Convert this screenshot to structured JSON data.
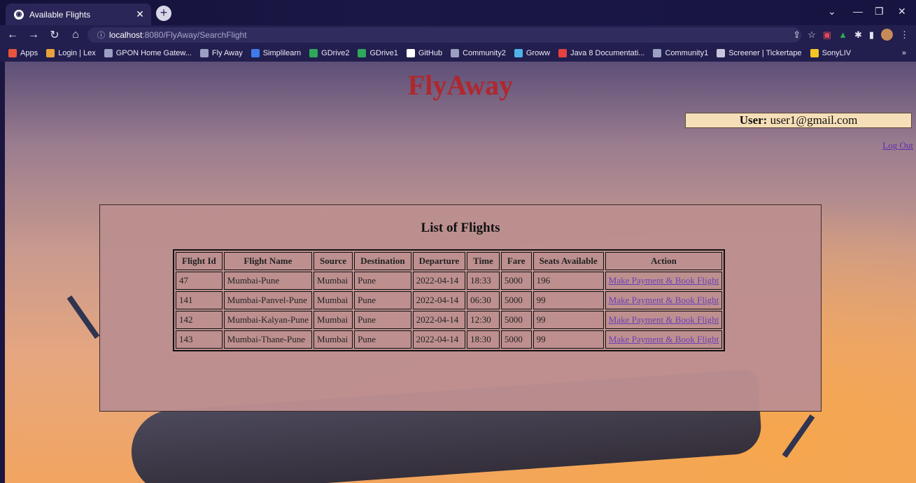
{
  "browser": {
    "tab_title": "Available Flights",
    "url_host": "localhost",
    "url_rest": ":8080/FlyAway/SearchFlight",
    "bookmarks": [
      {
        "label": "Apps",
        "color": "#e9543d"
      },
      {
        "label": "Login | Lex",
        "color": "#e8a23c"
      },
      {
        "label": "GPON Home Gatew...",
        "color": "#9aa0c2"
      },
      {
        "label": "Fly Away",
        "color": "#9aa0c2"
      },
      {
        "label": "Simplilearn",
        "color": "#3e7be8"
      },
      {
        "label": "GDrive2",
        "color": "#2fa75b"
      },
      {
        "label": "GDrive1",
        "color": "#2fa75b"
      },
      {
        "label": "GitHub",
        "color": "#ffffff"
      },
      {
        "label": "Community2",
        "color": "#9aa0c2"
      },
      {
        "label": "Groww",
        "color": "#4fb3e8"
      },
      {
        "label": "Java 8 Documentati...",
        "color": "#e64040"
      },
      {
        "label": "Community1",
        "color": "#9aa0c2"
      },
      {
        "label": "Screener | Tickertape",
        "color": "#c7c4dd"
      },
      {
        "label": "SonyLIV",
        "color": "#f3c623"
      }
    ]
  },
  "page": {
    "brand": "FlyAway",
    "user_label": "User:",
    "user_email": "user1@gmail.com",
    "logout": "Log Out",
    "list_title": "List of Flights",
    "columns": [
      "Flight Id",
      "Flight Name",
      "Source",
      "Destination",
      "Departure",
      "Time",
      "Fare",
      "Seats Available",
      "Action"
    ],
    "rows": [
      [
        "47",
        "Mumbai-Pune",
        "Mumbai",
        "Pune",
        "2022-04-14",
        "18:33",
        "5000",
        "196",
        "Make Payment & Book Flight"
      ],
      [
        "141",
        "Mumbai-Panvel-Pune",
        "Mumbai",
        "Pune",
        "2022-04-14",
        "06:30",
        "5000",
        "99",
        "Make Payment & Book Flight"
      ],
      [
        "142",
        "Mumbai-Kalyan-Pune",
        "Mumbai",
        "Pune",
        "2022-04-14",
        "12:30",
        "5000",
        "99",
        "Make Payment & Book Flight"
      ],
      [
        "143",
        "Mumbai-Thane-Pune",
        "Mumbai",
        "Pune",
        "2022-04-14",
        "18:30",
        "5000",
        "99",
        "Make Payment & Book Flight"
      ]
    ]
  },
  "colors": {
    "brand": "#b0272d",
    "link": "#6a3fb5",
    "user_box": "#f6dfb8"
  }
}
